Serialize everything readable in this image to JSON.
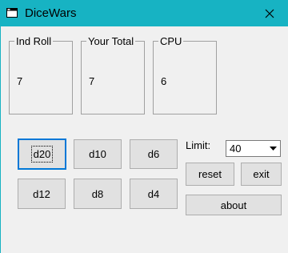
{
  "window": {
    "title": "DiceWars",
    "icon": "window-app-icon",
    "close_icon": "close-icon"
  },
  "groups": {
    "ind_roll": {
      "label": "Ind Roll",
      "value": "7"
    },
    "your_total": {
      "label": "Your Total",
      "value": "7"
    },
    "cpu": {
      "label": "CPU",
      "value": "6"
    }
  },
  "dice_buttons": {
    "d20": "d20",
    "d10": "d10",
    "d6": "d6",
    "d12": "d12",
    "d8": "d8",
    "d4": "d4"
  },
  "limit": {
    "label": "Limit:",
    "value": "40"
  },
  "actions": {
    "reset": "reset",
    "exit": "exit",
    "about": "about"
  },
  "colors": {
    "titlebar": "#17b3c3",
    "default_button_border": "#0078d7"
  }
}
